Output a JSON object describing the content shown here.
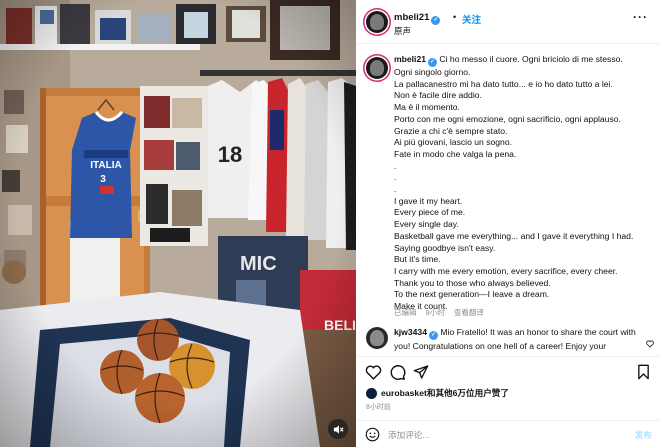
{
  "header": {
    "username": "mbeli21",
    "dot": "•",
    "follow_label": "关注",
    "audio_label": "原声",
    "more_label": "···"
  },
  "caption": {
    "username": "mbeli21",
    "lines": [
      "Ci ho messo il cuore. Ogni briciolo di me stesso.",
      "Ogni singolo giorno.",
      "La pallacanestro mi ha dato tutto... e io ho dato tutto a lei.",
      "Non è facile dire addio.",
      "Ma è il momento.",
      "Porto con me ogni emozione, ogni sacrificio, ogni applauso.",
      "Grazie a chi c'è sempre stato.",
      "Ai più giovani, lascio un sogno.",
      "Fate in modo che valga la pena.",
      ".",
      ".",
      ".",
      "I gave it my heart.",
      "Every piece of me.",
      "Every single day.",
      "Basketball gave me everything... and I gave it everything I had.",
      "Saying goodbye isn't easy.",
      "But it's time.",
      "I carry with me every emotion, every sacrifice, every cheer.",
      "Thank you to those who always believed.",
      "To the next generation—I leave a dream.",
      "Make it count."
    ],
    "meta": {
      "edited": "已编辑",
      "age": "8小时",
      "translate": "查看翻译"
    }
  },
  "comment": {
    "username": "kjw3434",
    "text": "Mio Fratello! It was an honor to share the court with you! Congratulations on one hell of a career! Enjoy your"
  },
  "actions": {
    "like_icon": "heart-icon",
    "comment_icon": "comment-bubble-icon",
    "share_icon": "paper-plane-icon",
    "save_icon": "bookmark-icon"
  },
  "likes": {
    "text": "eurobasket和其他6万位用户赞了"
  },
  "timestamp": "8小时前",
  "add_comment": {
    "placeholder": "添加评论...",
    "post_label": "发布"
  },
  "colors": {
    "accent": "#0095f6",
    "verified": "#3897f0",
    "meta_gray": "#8e8e8e",
    "post_disabled": "#b2dffc",
    "story_ring": "#d62976"
  }
}
